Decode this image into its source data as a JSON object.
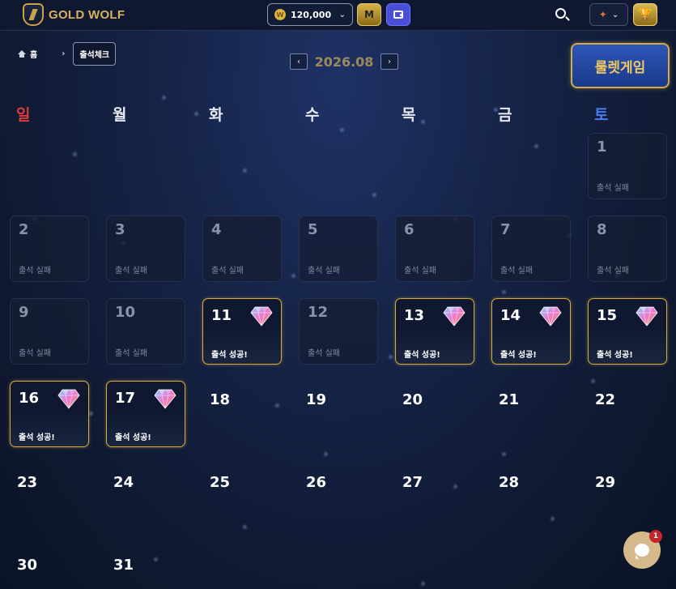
{
  "header": {
    "logo_text": "GOLD WOLF",
    "balance": "120,000",
    "coin_symbol": "W",
    "m_button": "M"
  },
  "breadcrumb": {
    "home": "홈",
    "current": "출석체크"
  },
  "calendar": {
    "month": "2026.08",
    "weekdays": [
      "일",
      "월",
      "화",
      "수",
      "목",
      "금",
      "토"
    ],
    "status_fail": "출석 실패",
    "status_success": "출석 성공!",
    "days": [
      {
        "n": "1",
        "status": "fail"
      },
      {
        "n": "2",
        "status": "fail"
      },
      {
        "n": "3",
        "status": "fail"
      },
      {
        "n": "4",
        "status": "fail"
      },
      {
        "n": "5",
        "status": "fail"
      },
      {
        "n": "6",
        "status": "fail"
      },
      {
        "n": "7",
        "status": "fail"
      },
      {
        "n": "8",
        "status": "fail"
      },
      {
        "n": "9",
        "status": "fail"
      },
      {
        "n": "10",
        "status": "fail"
      },
      {
        "n": "11",
        "status": "success"
      },
      {
        "n": "12",
        "status": "fail"
      },
      {
        "n": "13",
        "status": "success"
      },
      {
        "n": "14",
        "status": "success"
      },
      {
        "n": "15",
        "status": "success"
      },
      {
        "n": "16",
        "status": "success"
      },
      {
        "n": "17",
        "status": "success"
      },
      {
        "n": "18",
        "status": "none"
      },
      {
        "n": "19",
        "status": "none"
      },
      {
        "n": "20",
        "status": "none"
      },
      {
        "n": "21",
        "status": "none"
      },
      {
        "n": "22",
        "status": "none"
      },
      {
        "n": "23",
        "status": "none"
      },
      {
        "n": "24",
        "status": "none"
      },
      {
        "n": "25",
        "status": "none"
      },
      {
        "n": "26",
        "status": "none"
      },
      {
        "n": "27",
        "status": "none"
      },
      {
        "n": "28",
        "status": "none"
      },
      {
        "n": "29",
        "status": "none"
      },
      {
        "n": "30",
        "status": "none"
      },
      {
        "n": "31",
        "status": "none"
      }
    ]
  },
  "roulette_button": "룰렛게임",
  "chat": {
    "badge": "1"
  }
}
